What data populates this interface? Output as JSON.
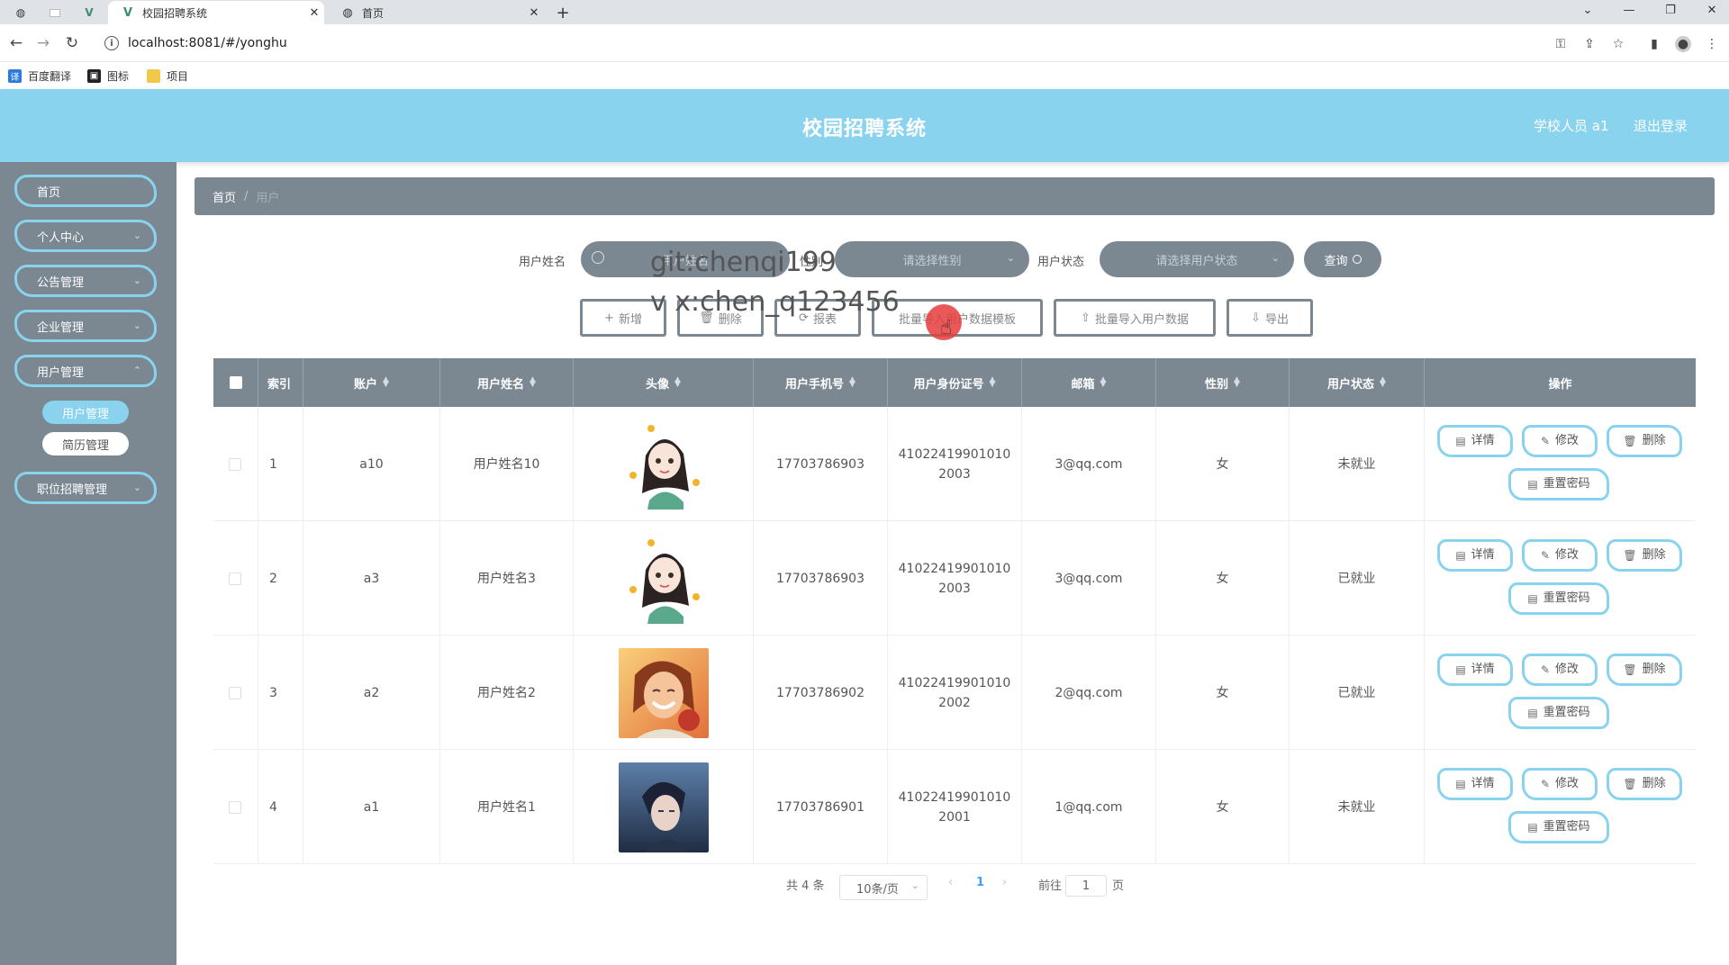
{
  "browser": {
    "tabs": [
      {
        "title": "校园招聘系统",
        "active": true
      },
      {
        "title": "首页",
        "active": false
      }
    ],
    "url": "localhost:8081/#/yonghu",
    "bookmarks": [
      "百度翻译",
      "图标",
      "项目"
    ]
  },
  "header": {
    "title": "校园招聘系统",
    "user": "学校人员 a1",
    "logout": "退出登录"
  },
  "sidebar": {
    "items": [
      {
        "label": "首页",
        "expandable": false
      },
      {
        "label": "个人中心",
        "expandable": true
      },
      {
        "label": "公告管理",
        "expandable": true
      },
      {
        "label": "企业管理",
        "expandable": true
      },
      {
        "label": "用户管理",
        "expandable": true
      },
      {
        "label": "职位招聘管理",
        "expandable": true
      }
    ],
    "subitems": [
      {
        "label": "用户管理",
        "active": true
      },
      {
        "label": "简历管理",
        "active": false
      }
    ]
  },
  "breadcrumb": {
    "home": "首页",
    "current": "用户"
  },
  "filters": {
    "name_label": "用户姓名",
    "name_placeholder": "用户姓名",
    "gender_label": "性别",
    "gender_placeholder": "请选择性别",
    "status_label": "用户状态",
    "status_placeholder": "请选择用户状态",
    "query": "查询"
  },
  "actions": {
    "add": "新增",
    "delete": "删除",
    "report": "报表",
    "import_template": "批量导入用户数据模板",
    "import_data": "批量导入用户数据",
    "export": "导出"
  },
  "watermark": {
    "line1": "git:chenqi199",
    "line2": "v x:chen_q123456"
  },
  "table": {
    "columns": [
      "索引",
      "账户",
      "用户姓名",
      "头像",
      "用户手机号",
      "用户身份证号",
      "邮箱",
      "性别",
      "用户状态",
      "操作"
    ],
    "rows": [
      {
        "index": "1",
        "account": "a10",
        "name": "用户姓名10",
        "avatar": "cartoon-girl",
        "phone": "17703786903",
        "id_card": "410224199010102003",
        "email": "3@qq.com",
        "gender": "女",
        "status": "未就业"
      },
      {
        "index": "2",
        "account": "a3",
        "name": "用户姓名3",
        "avatar": "cartoon-girl",
        "phone": "17703786903",
        "id_card": "410224199010102003",
        "email": "3@qq.com",
        "gender": "女",
        "status": "已就业"
      },
      {
        "index": "3",
        "account": "a2",
        "name": "用户姓名2",
        "avatar": "smiling-girl-photo",
        "phone": "17703786902",
        "id_card": "410224199010102002",
        "email": "2@qq.com",
        "gender": "女",
        "status": "已就业"
      },
      {
        "index": "4",
        "account": "a1",
        "name": "用户姓名1",
        "avatar": "anime-boy",
        "phone": "17703786901",
        "id_card": "410224199010102001",
        "email": "1@qq.com",
        "gender": "女",
        "status": "未就业"
      }
    ],
    "row_actions": {
      "detail": "详情",
      "edit": "修改",
      "delete": "删除",
      "reset": "重置密码"
    }
  },
  "pagination": {
    "total": "共 4 条",
    "page_size": "10条/页",
    "current": "1",
    "goto_prefix": "前往",
    "goto_value": "1",
    "goto_suffix": "页"
  },
  "colors": {
    "header": "#89d3ee",
    "sidebar": "#7b8791",
    "accent_border": "#89d3ee",
    "cursor_highlight": "#e63c3c"
  }
}
